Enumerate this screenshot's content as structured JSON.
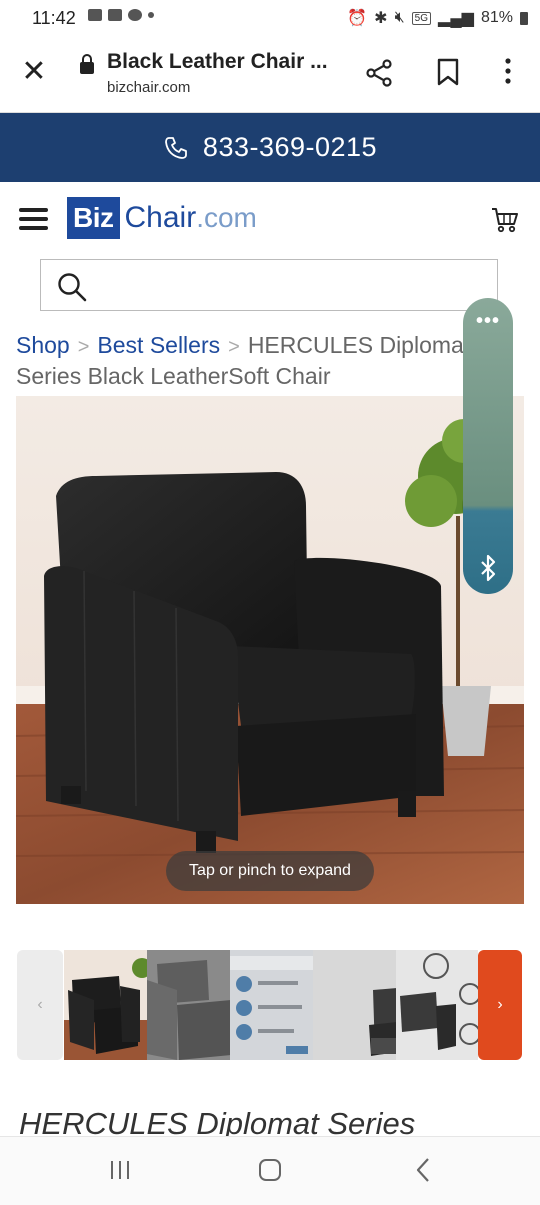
{
  "status_bar": {
    "time": "11:42",
    "battery": "81%",
    "network": "5G"
  },
  "browser": {
    "page_title": "Black Leather Chair ...",
    "url": "bizchair.com"
  },
  "phone_bar": {
    "phone": "833-369-0215"
  },
  "site": {
    "logo_biz": "Biz",
    "logo_chair": "Chair",
    "logo_com": ".com",
    "search_placeholder": ""
  },
  "breadcrumb": {
    "items": [
      "Shop",
      "Best Sellers",
      "HERCULES Diplomat Series Black LeatherSoft Chair"
    ],
    "separator": ">"
  },
  "hero": {
    "tap_hint": "Tap or pinch to expand"
  },
  "widget": {
    "more": "•••"
  },
  "thumbnails": {
    "prev": "‹",
    "next": "›"
  },
  "product_title": "HERCULES Diplomat Series",
  "colors": {
    "brand_navy": "#1d3f70",
    "brand_blue": "#1e4a9c",
    "accent_orange": "#e04a1e"
  }
}
